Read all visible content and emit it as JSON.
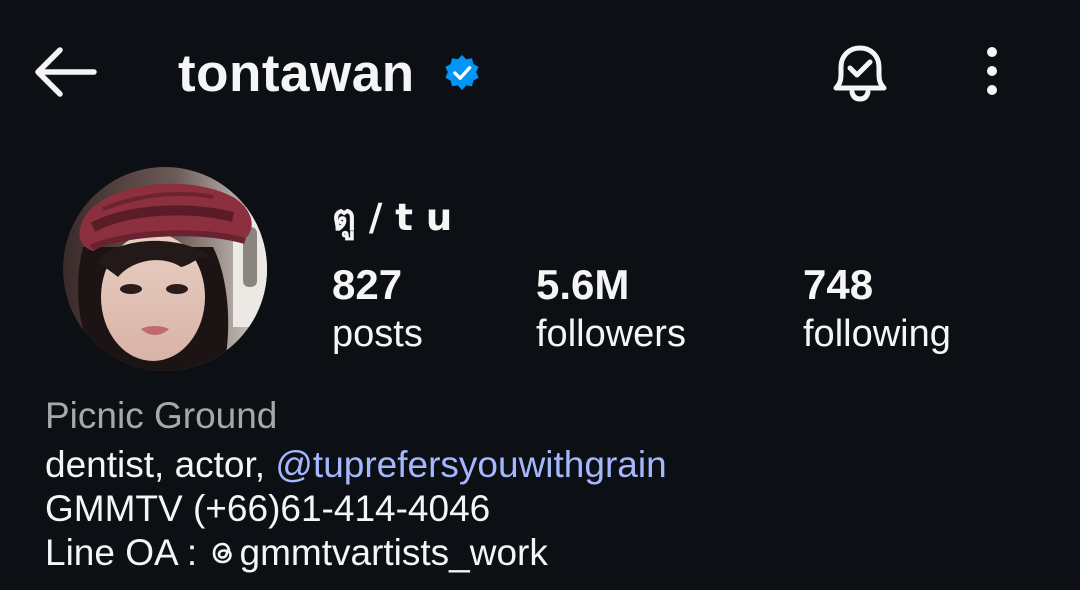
{
  "header": {
    "username": "tontawan",
    "verified": true,
    "icons": [
      "back-arrow-icon",
      "verified-badge-icon",
      "notification-bell-icon",
      "more-options-icon"
    ]
  },
  "profile": {
    "display_name": "ตู / t u",
    "avatar_icon": "profile-photo"
  },
  "stats": {
    "posts": {
      "value": "827",
      "label": "posts"
    },
    "followers": {
      "value": "5.6M",
      "label": "followers"
    },
    "following": {
      "value": "748",
      "label": "following"
    }
  },
  "bio": {
    "category": "Picnic Ground",
    "line1_text": "dentist, actor, ",
    "line1_mention": "@tuprefersyouwithgrain",
    "line2": "GMMTV (+66)61-414-4046",
    "line3_prefix": "Line OA : ",
    "line3_handle": "gmmtvartists_work"
  },
  "colors": {
    "background": "#0c1014",
    "text": "#f5f5f5",
    "secondary_text": "#a8a8a8",
    "mention": "#a4b7ff",
    "verified": "#0095f6"
  }
}
